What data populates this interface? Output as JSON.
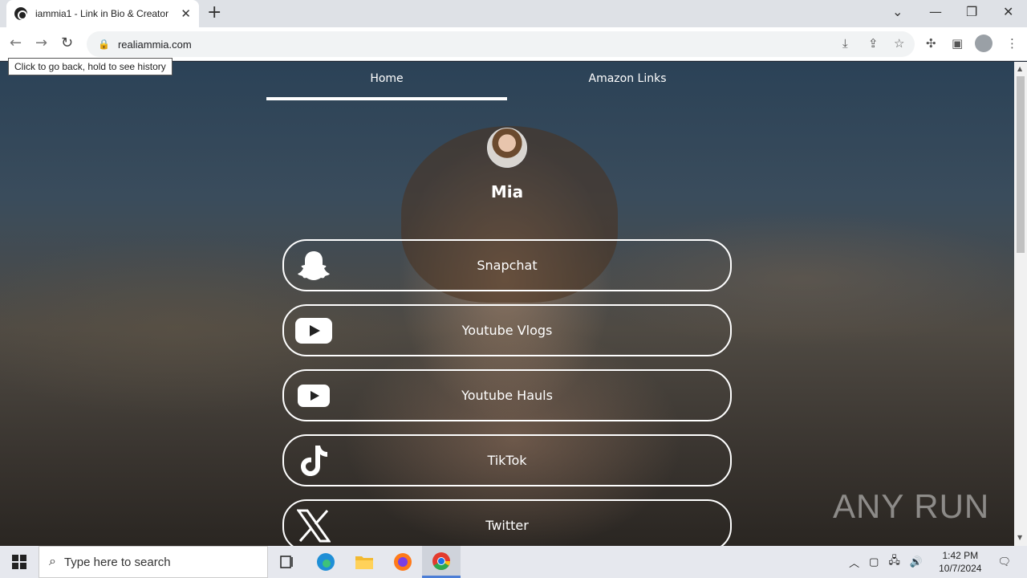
{
  "browser": {
    "tab_title": "iammia1 - Link in Bio & Creator",
    "url": "realiammia.com",
    "tooltip": "Click to go back, hold to see history"
  },
  "page": {
    "nav": [
      "Home",
      "Amazon Links"
    ],
    "active_nav": "Home",
    "profile_name": "Mia",
    "links": [
      {
        "label": "Snapchat",
        "icon": "snapchat-icon"
      },
      {
        "label": "Youtube Vlogs",
        "icon": "youtube-icon"
      },
      {
        "label": "Youtube Hauls",
        "icon": "youtube-icon"
      },
      {
        "label": "TikTok",
        "icon": "tiktok-icon"
      },
      {
        "label": "Twitter",
        "icon": "x-twitter-icon"
      }
    ],
    "watermark": "ANY RUN"
  },
  "taskbar": {
    "search_placeholder": "Type here to search",
    "time": "1:42 PM",
    "date": "10/7/2024"
  },
  "colors": {
    "youtube_red": "#ff0000",
    "accent": "#ffffff"
  }
}
